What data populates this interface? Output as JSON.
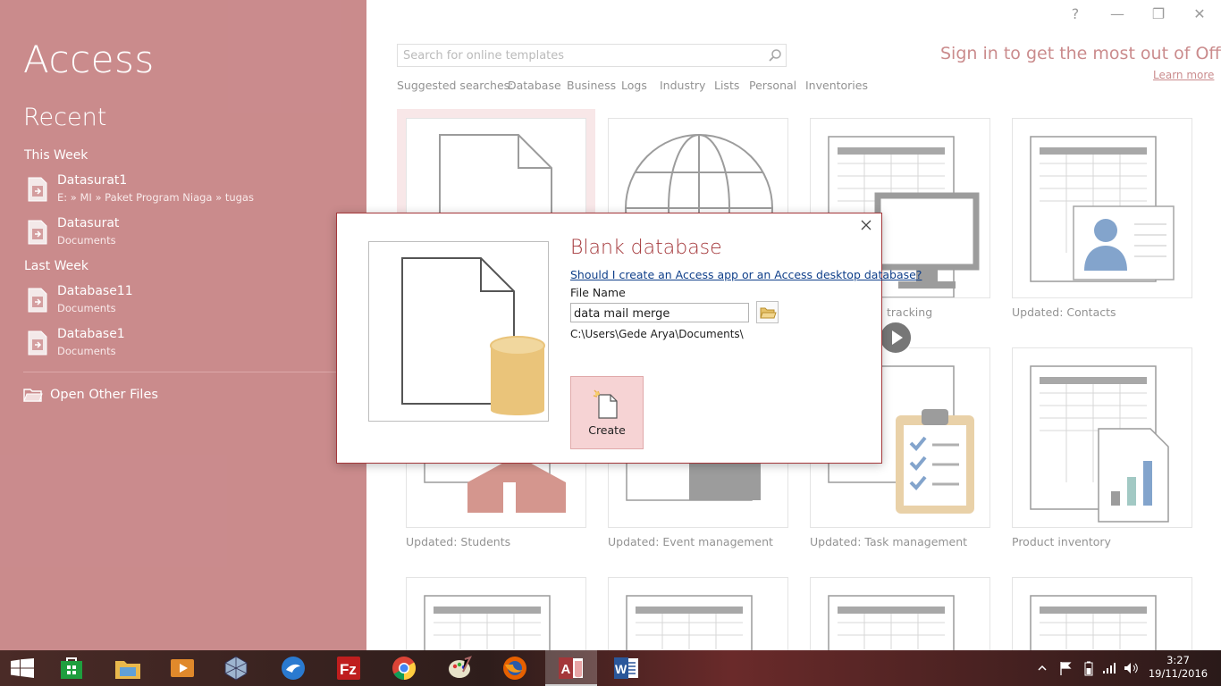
{
  "window": {
    "help_label": "?",
    "minimize_label": "—",
    "restore_label": "❐",
    "close_label": "✕"
  },
  "left_pane": {
    "app_title": "Access",
    "recent_heading": "Recent",
    "groups": [
      {
        "label": "This Week",
        "files": [
          {
            "name": "Datasurat1",
            "path": "E: » MI » Paket Program Niaga » tugas"
          },
          {
            "name": "Datasurat",
            "path": "Documents"
          }
        ]
      },
      {
        "label": "Last Week",
        "files": [
          {
            "name": "Database11",
            "path": "Documents"
          },
          {
            "name": "Database1",
            "path": "Documents"
          }
        ]
      }
    ],
    "open_other": "Open Other Files",
    "accent_color": "#a4373a"
  },
  "search": {
    "placeholder": "Search for online templates",
    "value": "",
    "suggested_label": "Suggested searches:",
    "suggestions": [
      "Database",
      "Business",
      "Logs",
      "Industry",
      "Lists",
      "Personal",
      "Inventories"
    ]
  },
  "account": {
    "sign_in_text": "Sign in to get the most out of Office",
    "learn_more": "Learn more"
  },
  "templates": {
    "row1_labels": [
      "",
      "",
      "tracking",
      "Updated: Contacts"
    ],
    "row2_labels": [
      "Updated: Students",
      "Updated: Event management",
      "Updated: Task management",
      "Product inventory"
    ]
  },
  "dialog": {
    "title": "Blank database",
    "help_link": "Should I create an Access app or an Access desktop database?",
    "file_name_label": "File Name",
    "file_name_value": "data mail merge",
    "path": "C:\\Users\\Gede Arya\\Documents\\",
    "create_label": "Create"
  },
  "taskbar": {
    "apps": [
      "start",
      "store",
      "file-explorer",
      "media-player",
      "virtualbox",
      "app-bird",
      "filezilla",
      "chrome",
      "paint",
      "firefox",
      "access",
      "word"
    ],
    "clock_time": "3:27",
    "clock_date": "19/11/2016"
  }
}
